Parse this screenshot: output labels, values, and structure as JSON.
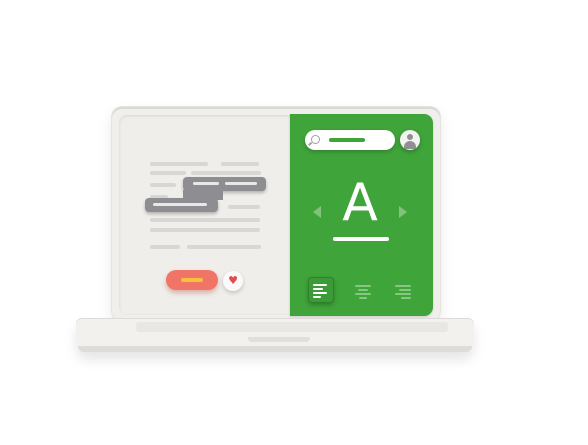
{
  "illustration": {
    "editor_panel": {
      "accent_color": "#3fa43a",
      "font_preview_letter": "A",
      "icons": [
        "search-icon",
        "user-avatar-icon",
        "prev-arrow-icon",
        "next-arrow-icon",
        "align-left-icon",
        "align-center-icon",
        "align-right-icon"
      ]
    },
    "document_panel": {
      "primary_button_color": "#f17567",
      "favorite_icon": "♥"
    }
  }
}
